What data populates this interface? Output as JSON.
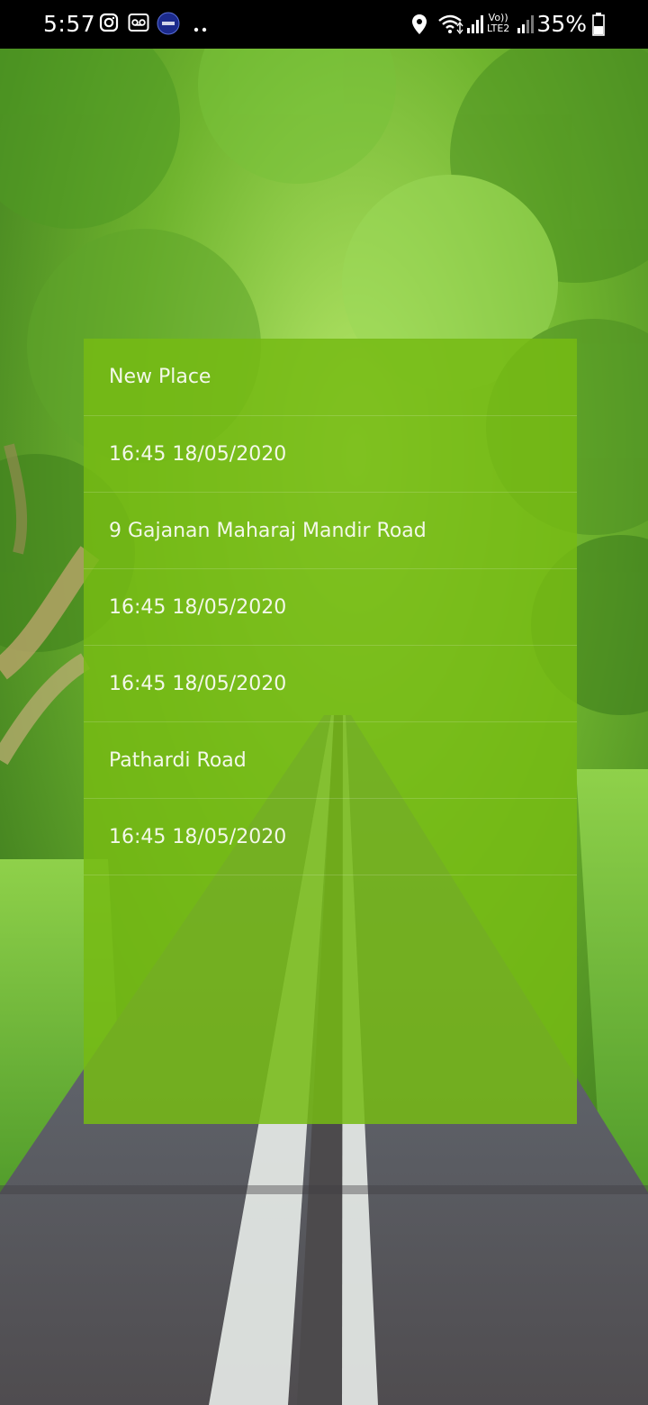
{
  "status_bar": {
    "time": "5:57",
    "battery": "35%",
    "left_icons": [
      "instagram-icon",
      "voicemail-icon",
      "app-badge-icon",
      "more-dots-icon"
    ],
    "right_icons": [
      "location-icon",
      "wifi-icon",
      "signal-icon",
      "volte-icon",
      "signal-icon-2",
      "battery-icon"
    ],
    "volte_label_top": "Vo))",
    "volte_label_bottom": "LTE2"
  },
  "panel": {
    "background": "#76BA14",
    "items": [
      {
        "label": "New Place"
      },
      {
        "label": "16:45 18/05/2020"
      },
      {
        "label": "9 Gajanan Maharaj Mandir Road"
      },
      {
        "label": "16:45 18/05/2020"
      },
      {
        "label": "16:45 18/05/2020"
      },
      {
        "label": "Pathardi Road"
      },
      {
        "label": "16:45 18/05/2020"
      }
    ]
  }
}
